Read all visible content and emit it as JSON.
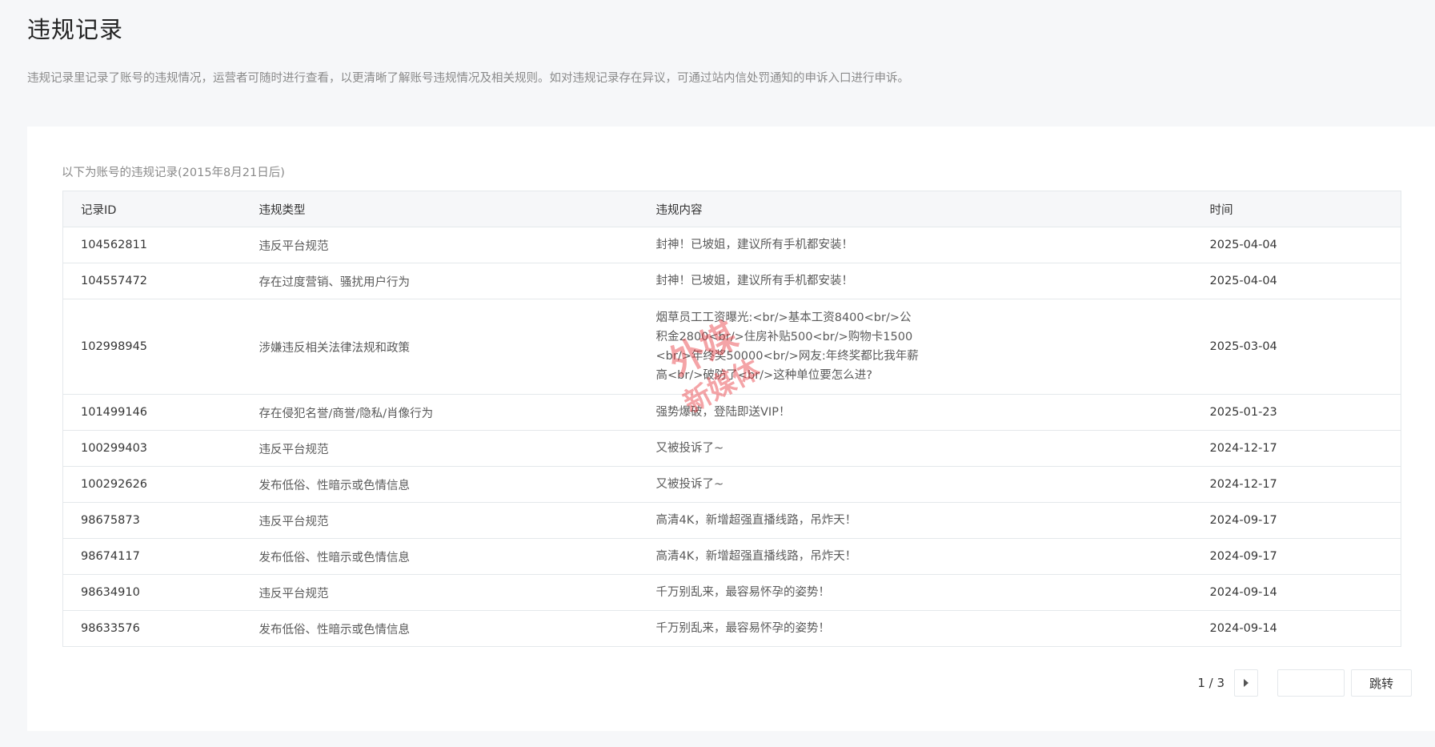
{
  "page": {
    "title": "违规记录",
    "intro": "违规记录里记录了账号的违规情况，运营者可随时进行查看，以更清晰了解账号违规情况及相关规则。如对违规记录存在异议，可通过站内信处罚通知的申诉入口进行申诉。"
  },
  "records": {
    "caption": "以下为账号的违规记录(2015年8月21日后)",
    "columns": [
      "记录ID",
      "违规类型",
      "违规内容",
      "时间"
    ],
    "rows": [
      {
        "id": "104562811",
        "type": "违反平台规范",
        "content": "封神！已坡姐，建议所有手机都安装！",
        "time": "2025-04-04"
      },
      {
        "id": "104557472",
        "type": "存在过度营销、骚扰用户行为",
        "content": "封神！已坡姐，建议所有手机都安装！",
        "time": "2025-04-04"
      },
      {
        "id": "102998945",
        "type": "涉嫌违反相关法律法规和政策",
        "content": "烟草员工工资曝光:<br/>基本工资8400<br/>公积金2800<br/>住房补贴500<br/>购物卡1500<br/>年终奖50000<br/>网友:年终奖都比我年薪高<br/>破防了<br/>这种单位要怎么进?",
        "time": "2025-03-04"
      },
      {
        "id": "101499146",
        "type": "存在侵犯名誉/商誉/隐私/肖像行为",
        "content": "强势爆破，登陆即送VIP！",
        "time": "2025-01-23"
      },
      {
        "id": "100299403",
        "type": "违反平台规范",
        "content": "又被投诉了~",
        "time": "2024-12-17"
      },
      {
        "id": "100292626",
        "type": "发布低俗、性暗示或色情信息",
        "content": "又被投诉了~",
        "time": "2024-12-17"
      },
      {
        "id": "98675873",
        "type": "违反平台规范",
        "content": "高清4K，新增超强直播线路，吊炸天！",
        "time": "2024-09-17"
      },
      {
        "id": "98674117",
        "type": "发布低俗、性暗示或色情信息",
        "content": "高清4K，新增超强直播线路，吊炸天！",
        "time": "2024-09-17"
      },
      {
        "id": "98634910",
        "type": "违反平台规范",
        "content": "千万别乱来，最容易怀孕的姿势！",
        "time": "2024-09-14"
      },
      {
        "id": "98633576",
        "type": "发布低俗、性暗示或色情信息",
        "content": "千万别乱来，最容易怀孕的姿势！",
        "time": "2024-09-14"
      }
    ]
  },
  "pager": {
    "page_info": "1 / 3",
    "next_icon": "caret-right-icon",
    "input_value": "",
    "jump_label": "跳转"
  },
  "watermark": {
    "text_top": "外媒",
    "text_bottom": "新媒体",
    "color": "#e8383d"
  }
}
